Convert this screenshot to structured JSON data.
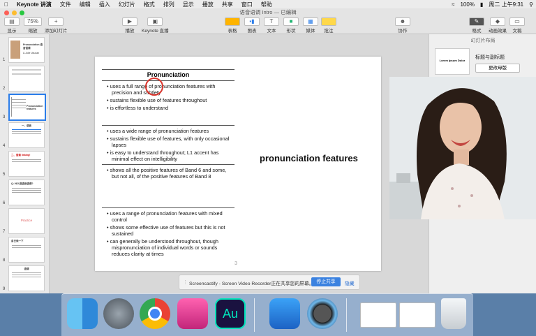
{
  "menubar": {
    "apple": "",
    "items": [
      "Keynote 讲演",
      "文件",
      "编辑",
      "插入",
      "幻灯片",
      "格式",
      "排列",
      "显示",
      "播放",
      "共享",
      "窗口",
      "帮助"
    ],
    "right": [
      "100%",
      "周二 上午9:31"
    ]
  },
  "window": {
    "title": "语音语调 Intro — 已编辑"
  },
  "toolbar": {
    "display": "显示",
    "zoom_value": "75%",
    "zoom": "缩放",
    "add_slide": "添加幻灯片",
    "play": "播放",
    "keynote_live": "Keynote 直播",
    "table": "表格",
    "chart": "图表",
    "text": "文本",
    "shape": "形状",
    "media": "媒体",
    "comment": "批注",
    "collaborate": "协作",
    "format": "格式",
    "animate": "动画效果",
    "document": "文稿"
  },
  "inspector": {
    "header": "幻灯片布局",
    "layout_name": "标题与副标题",
    "change_master": "更改母版",
    "thumb_text": "Lorem Ipsum Dolor"
  },
  "navigator": {
    "slides": [
      {
        "num": "1",
        "title": "Pronunciation 语音语调",
        "sub": "& Jolie Vauxan"
      },
      {
        "num": "2",
        "title": "",
        "sub": ""
      },
      {
        "num": "3",
        "title": "",
        "sub": "Pronunciation features"
      },
      {
        "num": "4",
        "title": "一、语音",
        "sub": ""
      },
      {
        "num": "5",
        "title": "二、连读 linking!",
        "sub": ""
      },
      {
        "num": "6",
        "title": "Q: 什么是语音语调?",
        "sub": ""
      },
      {
        "num": "7",
        "title": "Practice",
        "sub": ""
      },
      {
        "num": "8",
        "title": "自己读一下",
        "sub": ""
      },
      {
        "num": "9",
        "title": "语调",
        "sub": ""
      }
    ]
  },
  "slide": {
    "heading": "Pronunciation",
    "band9": [
      "uses a full range of pronunciation features with precision and subtlety",
      "sustains flexible use of features throughout",
      "is effortless to understand"
    ],
    "band8": [
      "uses a wide range of pronunciation features",
      "sustains flexible use of features, with only occasional lapses",
      "is easy to understand throughout; L1 accent has minimal effect on intelligibility"
    ],
    "band7": [
      "shows all the positive features of Band 6 and some, but not all, of the positive features of Band 8"
    ],
    "band6": [
      "uses a range of pronunciation features with mixed control",
      "shows some effective use of features but this is not sustained",
      "can generally be understood throughout, though mispronunciation of individual words or sounds reduces clarity at times"
    ],
    "side_text": "pronunciation features",
    "page_number": "3"
  },
  "banner": {
    "text": "Screencastify - Screen Video Recorder正在共享您的屏幕。",
    "stop": "停止共享",
    "hide": "隐藏"
  },
  "dock": {
    "apps": [
      "finder-icon",
      "launchpad-icon",
      "chrome-icon",
      "cleanmymac-icon",
      "audition-icon",
      "keynote-icon",
      "quicktime-icon",
      "window-thumb-1",
      "window-thumb-2",
      "trash-icon"
    ],
    "audition_label": "Au"
  },
  "colors": {
    "accent": "#2b7de9",
    "stop_button": "#3b82e0"
  }
}
